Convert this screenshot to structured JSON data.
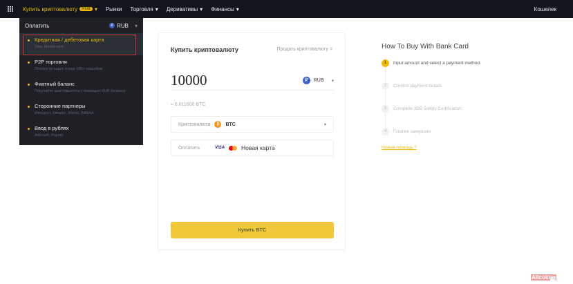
{
  "nav": {
    "buy_crypto": "Купить криптовалюту",
    "badge": "RUB",
    "markets": "Рынки",
    "trading": "Торговля",
    "derivatives": "Деривативы",
    "finance": "Финансы",
    "wallet": "Кошелек"
  },
  "dropdown": {
    "pay_label": "Оплатить",
    "currency": "RUB",
    "options": [
      {
        "title": "Кредитная / дебетовая карта",
        "sub": "Visa, Mastercard"
      },
      {
        "title": "P2P торговля",
        "sub": "Оплата по карте и еще 100+ способов"
      },
      {
        "title": "Фиатный баланс",
        "sub": "Покупайте криптовалюты с помощью RUB баланса"
      },
      {
        "title": "Сторонние партнеры",
        "sub": "Mercuryo, Simplex, Koinal, BANXA"
      },
      {
        "title": "Ввод в рублях",
        "sub": "Advcash, Payeer"
      }
    ]
  },
  "card": {
    "title": "Купить криптовалюту",
    "sell_link": "Продать криптовалюту >",
    "amount": "10000",
    "currency": "RUB",
    "approx": "≈ 0.011600 BTC",
    "crypto_label": "Криптовалюта",
    "crypto": "BTC",
    "pay_label": "Оплатить",
    "visa": "VISA",
    "payment": "Новая карта",
    "buy_button": "Купить BTC"
  },
  "how": {
    "title": "How To Buy With Bank Card",
    "steps": [
      {
        "n": "1",
        "text": "Input amount and select a payment method."
      },
      {
        "n": "2",
        "text": "Confirm payment details."
      },
      {
        "n": "3",
        "text": "Complete 3DS Safety Certification."
      },
      {
        "n": "4",
        "text": "Платеж завершен"
      }
    ],
    "help": "Нужна помощь ?"
  },
  "watermark": {
    "a": "Altcoin",
    "b": "log"
  }
}
